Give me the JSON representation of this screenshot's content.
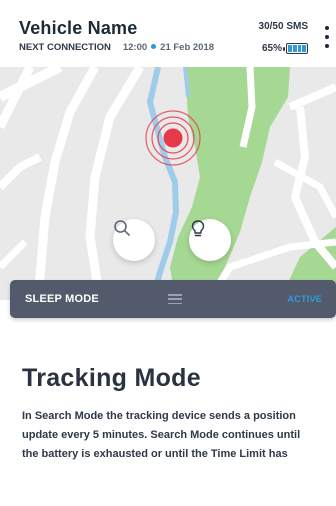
{
  "header": {
    "title": "Vehicle Name",
    "next_connection_label": "NEXT CONNECTION",
    "next_connection_time": "12:00",
    "next_connection_date": "21 Feb 2018",
    "sms_count": "30/50 SMS",
    "battery_percent": "65%",
    "battery_level": 0.65
  },
  "map": {
    "search_button_icon": "search-icon",
    "location_button_icon": "lightbulb-icon",
    "marker_icon": "location-pulse-icon"
  },
  "sleep_mode": {
    "label": "SLEEP MODE",
    "status": "ACTIVE"
  },
  "mode": {
    "title": "Tracking Mode",
    "description": "In Search Mode the tracking device sends a position update every 5 minutes. Search Mode continues until the battery is exhausted or until the Time Limit has"
  },
  "colors": {
    "accent": "#2f9bd6",
    "park": "#a5d893",
    "water": "#9ecce9",
    "marker": "#e8394b",
    "panel": "#525a6c"
  }
}
